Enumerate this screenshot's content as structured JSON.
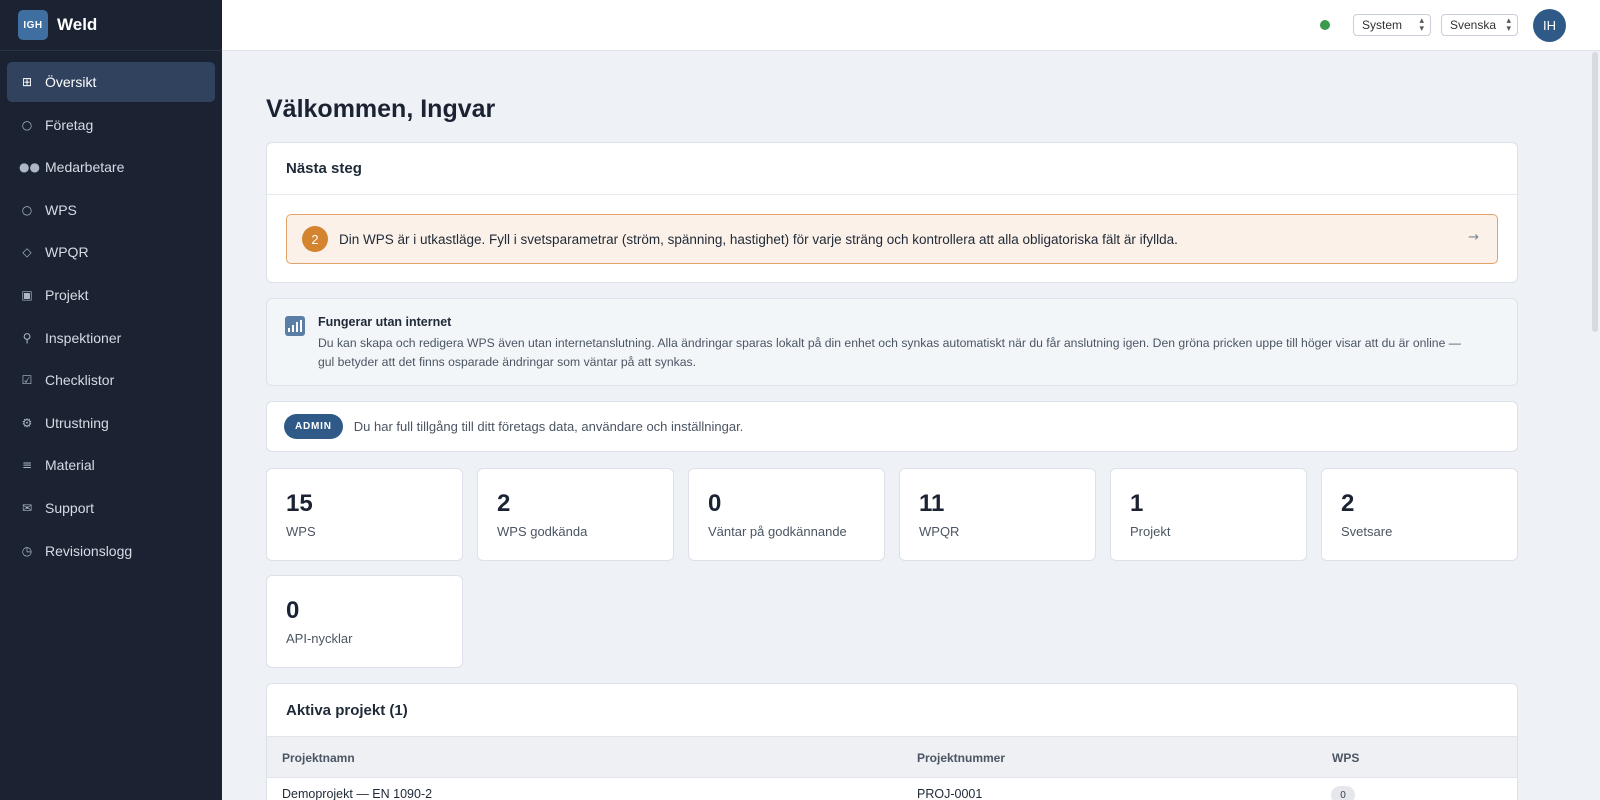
{
  "brand": {
    "logo_text": "IGH",
    "name": "Weld"
  },
  "sidebar": {
    "items": [
      {
        "label": "Översikt",
        "icon": "grid-icon",
        "active": true
      },
      {
        "label": "Företag",
        "icon": "building-icon"
      },
      {
        "label": "Medarbetare",
        "icon": "users-icon"
      },
      {
        "label": "WPS",
        "icon": "circle-icon"
      },
      {
        "label": "WPQR",
        "icon": "diamond-icon"
      },
      {
        "label": "Projekt",
        "icon": "square-icon"
      },
      {
        "label": "Inspektioner",
        "icon": "magnifier-icon"
      },
      {
        "label": "Checklistor",
        "icon": "checkbox-icon"
      },
      {
        "label": "Utrustning",
        "icon": "gear-icon"
      },
      {
        "label": "Material",
        "icon": "list-icon"
      },
      {
        "label": "Support",
        "icon": "mail-icon"
      },
      {
        "label": "Revisionslogg",
        "icon": "clock-icon"
      }
    ]
  },
  "topbar": {
    "status": "online",
    "status_color": "#3a9a4d",
    "theme_select": "System",
    "language_select": "Svenska",
    "avatar_initials": "IH"
  },
  "main": {
    "title": "Välkommen, Ingvar",
    "next_steps": {
      "heading": "Nästa steg",
      "step_number": "2",
      "step_text": "Din WPS är i utkastläge. Fyll i svetsparametrar (ström, spänning, hastighet) för varje sträng och kontrollera att alla obligatoriska fält är ifyllda."
    },
    "offline": {
      "title": "Fungerar utan internet",
      "text": "Du kan skapa och redigera WPS även utan internetanslutning. Alla ändringar sparas lokalt på din enhet och synkas automatiskt när du får anslutning igen. Den gröna pricken uppe till höger visar att du är online — gul betyder att det finns osparade ändringar som väntar på att synkas."
    },
    "role": {
      "badge": "ADMIN",
      "text": "Du har full tillgång till ditt företags data, användare och inställningar."
    },
    "stats": [
      {
        "value": "15",
        "label": "WPS"
      },
      {
        "value": "2",
        "label": "WPS godkända"
      },
      {
        "value": "0",
        "label": "Väntar på godkännande"
      },
      {
        "value": "11",
        "label": "WPQR"
      },
      {
        "value": "1",
        "label": "Projekt"
      },
      {
        "value": "2",
        "label": "Svetsare"
      },
      {
        "value": "0",
        "label": "API-nycklar"
      }
    ],
    "projects": {
      "heading": "Aktiva projekt (1)",
      "columns": [
        "Projektnamn",
        "Projektnummer",
        "WPS"
      ],
      "rows": [
        {
          "name": "Demoprojekt — EN 1090-2",
          "number": "PROJ-0001",
          "wps": "0"
        }
      ]
    }
  },
  "colors": {
    "accent": "#2f5a88",
    "sidebar_bg": "#1b2333",
    "step_badge": "#d4832e"
  }
}
